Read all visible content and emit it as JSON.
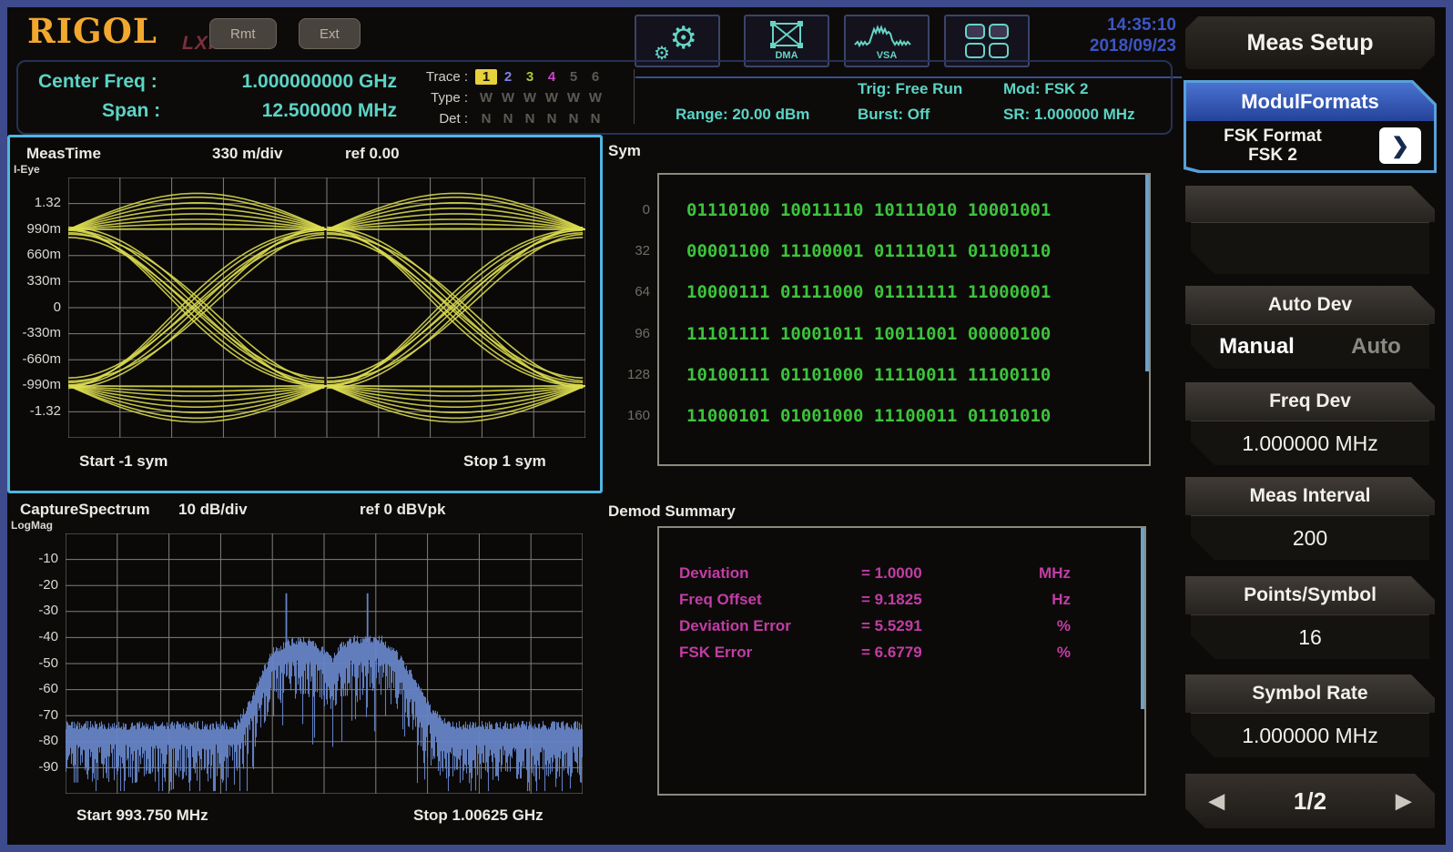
{
  "header": {
    "logo": "RIGOL",
    "lxi": "LXI",
    "rmt_label": "Rmt",
    "ext_label": "Ext",
    "icons": [
      "settings-gears-icon",
      "dma-constellation-icon",
      "vsa-spectrum-icon",
      "window-layout-icon"
    ],
    "dma_label": "DMA",
    "vsa_label": "VSA",
    "time": "14:35:10",
    "date": "2018/09/23"
  },
  "status_bar": {
    "center_freq_label": "Center Freq :",
    "center_freq_value": "1.000000000 GHz",
    "span_label": "Span :",
    "span_value": "12.500000 MHz",
    "trace_label": "Trace :",
    "trace_values": [
      "1",
      "2",
      "3",
      "4",
      "5",
      "6"
    ],
    "trace_colors": [
      "#e8d23c",
      "#8080e8",
      "#a8c838",
      "#c944c9",
      "#5a5a54",
      "#5a5a54"
    ],
    "type_label": "Type :",
    "type_values": [
      "W",
      "W",
      "W",
      "W",
      "W",
      "W"
    ],
    "det_label": "Det :",
    "det_values": [
      "N",
      "N",
      "N",
      "N",
      "N",
      "N"
    ],
    "range": "Range: 20.00 dBm",
    "trig": "Trig: Free Run",
    "burst": "Burst: Off",
    "mod": "Mod: FSK 2",
    "sr": "SR: 1.000000 MHz"
  },
  "eye_panel": {
    "title": "MeasTime",
    "scale": "330 m/div",
    "ref": "ref 0.00",
    "mode": "I-Eye",
    "y_ticks": [
      "1.32",
      "990m",
      "660m",
      "330m",
      "0",
      "-330m",
      "-660m",
      "-990m",
      "-1.32"
    ],
    "x_start": "Start -1 sym",
    "x_stop": "Stop 1 sym"
  },
  "sym_panel": {
    "title": "Sym",
    "rows": [
      {
        "index": "0",
        "bits": "01110100 10011110 10111010 10001001"
      },
      {
        "index": "32",
        "bits": "00001100 11100001 01111011 01100110"
      },
      {
        "index": "64",
        "bits": "10000111 01111000 01111111 11000001"
      },
      {
        "index": "96",
        "bits": "11101111 10001011 10011001 00000100"
      },
      {
        "index": "128",
        "bits": "10100111 01101000 11110011 11100110"
      },
      {
        "index": "160",
        "bits": "11000101 01001000 11100011 01101010"
      }
    ]
  },
  "spectrum_panel": {
    "title": "CaptureSpectrum",
    "scale": "10 dB/div",
    "ref": "ref 0 dBVpk",
    "mode": "LogMag",
    "y_ticks": [
      "-10",
      "-20",
      "-30",
      "-40",
      "-50",
      "-60",
      "-70",
      "-80",
      "-90"
    ],
    "x_start": "Start 993.750 MHz",
    "x_stop": "Stop 1.00625 GHz"
  },
  "demod_panel": {
    "title": "Demod Summary",
    "rows": [
      {
        "name": "Deviation",
        "value": "= 1.0000",
        "unit": "MHz"
      },
      {
        "name": "Freq Offset",
        "value": "= 9.1825",
        "unit": "Hz"
      },
      {
        "name": "Deviation Error",
        "value": "= 5.5291",
        "unit": "%"
      },
      {
        "name": "FSK Error",
        "value": "= 6.6779",
        "unit": "%"
      }
    ]
  },
  "sidebar": {
    "title": "Meas Setup",
    "modul_formats": {
      "header": "ModulFormats",
      "line1": "FSK Format",
      "line2": "FSK 2",
      "arrow": "❯"
    },
    "auto_dev": {
      "label": "Auto Dev",
      "options": [
        "Manual",
        "Auto"
      ],
      "selected": "Manual"
    },
    "groups": [
      {
        "label": "Freq Dev",
        "value": "1.000000 MHz"
      },
      {
        "label": "Meas Interval",
        "value": "200"
      },
      {
        "label": "Points/Symbol",
        "value": "16"
      },
      {
        "label": "Symbol Rate",
        "value": "1.000000 MHz"
      }
    ],
    "pagination": {
      "page": "1/2",
      "prev": "◀",
      "next": "▶"
    }
  },
  "chart_data": [
    {
      "type": "line",
      "subtype": "eye-diagram",
      "title": "MeasTime I-Eye",
      "scale_per_div": "330 m/div",
      "ref": 0.0,
      "y_ticks": [
        1.32,
        0.99,
        0.66,
        0.33,
        0,
        -0.33,
        -0.66,
        -0.99,
        -1.32
      ],
      "ylim": [
        -1.65,
        1.65
      ],
      "x_range_sym": [
        -1,
        1
      ],
      "convergence_level": 0.99,
      "lens_peaks": [
        1.0,
        1.06,
        1.12,
        1.19,
        1.26,
        1.33,
        1.4,
        1.45
      ],
      "transition_variants": [
        [
          1.0,
          0.0
        ],
        [
          0.96,
          0.05
        ],
        [
          1.03,
          -0.05
        ],
        [
          0.99,
          0.1
        ],
        [
          0.94,
          -0.09
        ],
        [
          1.01,
          0.14
        ],
        [
          0.9,
          0.03
        ]
      ],
      "grid": [
        10,
        10
      ],
      "trace_color": "#dcdc50",
      "grid_color": "#8d8d85"
    },
    {
      "type": "area",
      "subtype": "spectrum",
      "title": "CaptureSpectrum LogMag",
      "db_per_div": 10,
      "ref_db": 0,
      "ylim_db": [
        -100,
        0
      ],
      "x_start": "993.750 MHz",
      "x_stop": "1.00625 GHz",
      "noise_floor_db": -77,
      "envelope": [
        [
          0,
          -77
        ],
        [
          0.33,
          -77
        ],
        [
          0.36,
          -66
        ],
        [
          0.4,
          -48
        ],
        [
          0.43,
          -45
        ],
        [
          0.46,
          -44
        ],
        [
          0.49,
          -47
        ],
        [
          0.515,
          -52
        ],
        [
          0.53,
          -46
        ],
        [
          0.56,
          -44
        ],
        [
          0.61,
          -44
        ],
        [
          0.63,
          -47
        ],
        [
          0.67,
          -58
        ],
        [
          0.71,
          -72
        ],
        [
          0.74,
          -77
        ],
        [
          1,
          -77
        ]
      ],
      "peaks_db": [
        {
          "x": 0.427,
          "db": -23
        },
        {
          "x": 0.584,
          "db": -23
        }
      ],
      "grid": [
        10,
        10
      ],
      "trace_color": "#6684c6",
      "grid_color": "#8d8d85"
    }
  ]
}
